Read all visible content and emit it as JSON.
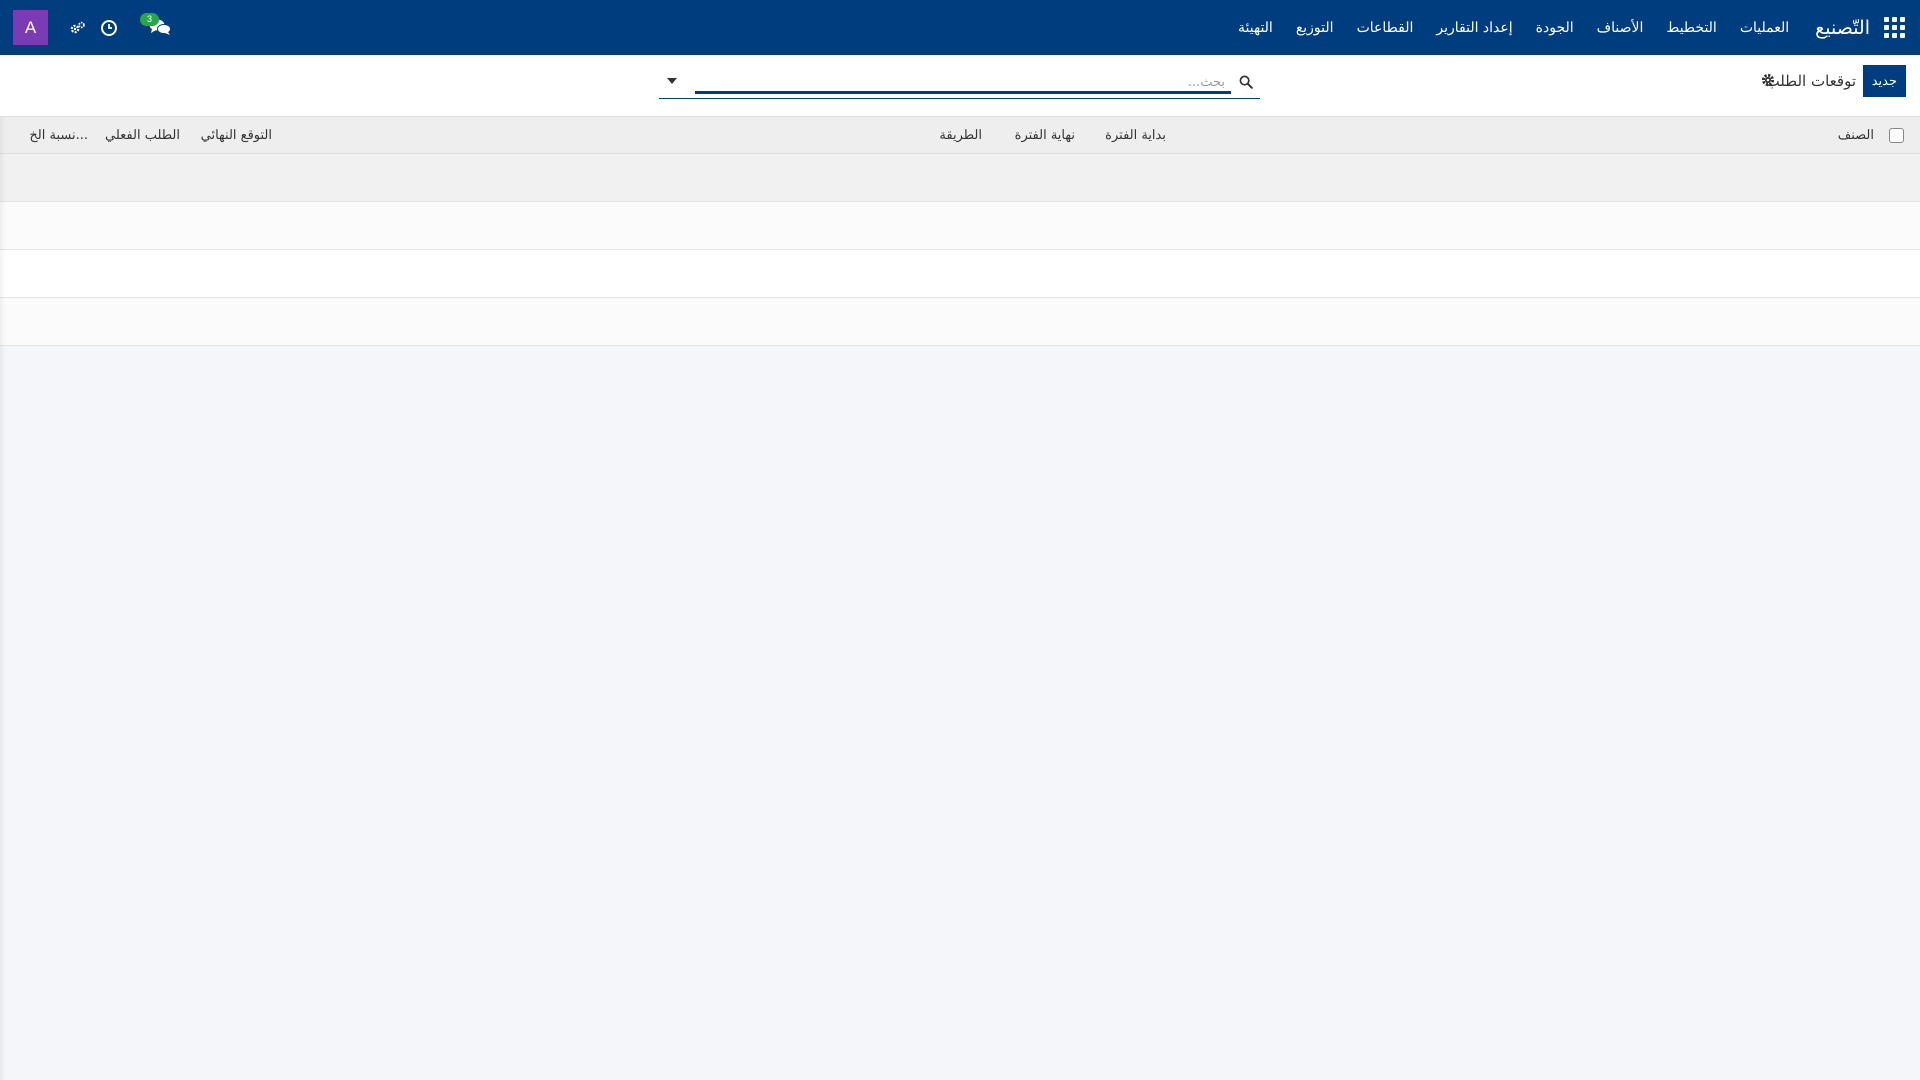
{
  "navbar": {
    "brand": "التّصنيع",
    "menu": [
      "العمليات",
      "التخطيط",
      "الأصناف",
      "الجودة",
      "إعداد التقارير",
      "القطاعات",
      "التوزيع",
      "التهيئة"
    ],
    "avatar_letter": "A",
    "chat_badge_count": "3"
  },
  "control_panel": {
    "new_button": "جديد",
    "breadcrumb": "توقعات الطلب"
  },
  "search": {
    "placeholder": "بحث..."
  },
  "table": {
    "columns": {
      "product": "الصنف",
      "period_start": "بداية الفترة",
      "period_end": "نهاية الفترة",
      "method": "الطريقة",
      "final_forecast": "التوقع النهائي",
      "actual_demand": "الطلب الفعلي",
      "ratio": "نسبة الخ..."
    }
  },
  "colors": {
    "navbar": "#003d7e",
    "avatar": "#7a3bb5",
    "badge": "#28a745"
  }
}
